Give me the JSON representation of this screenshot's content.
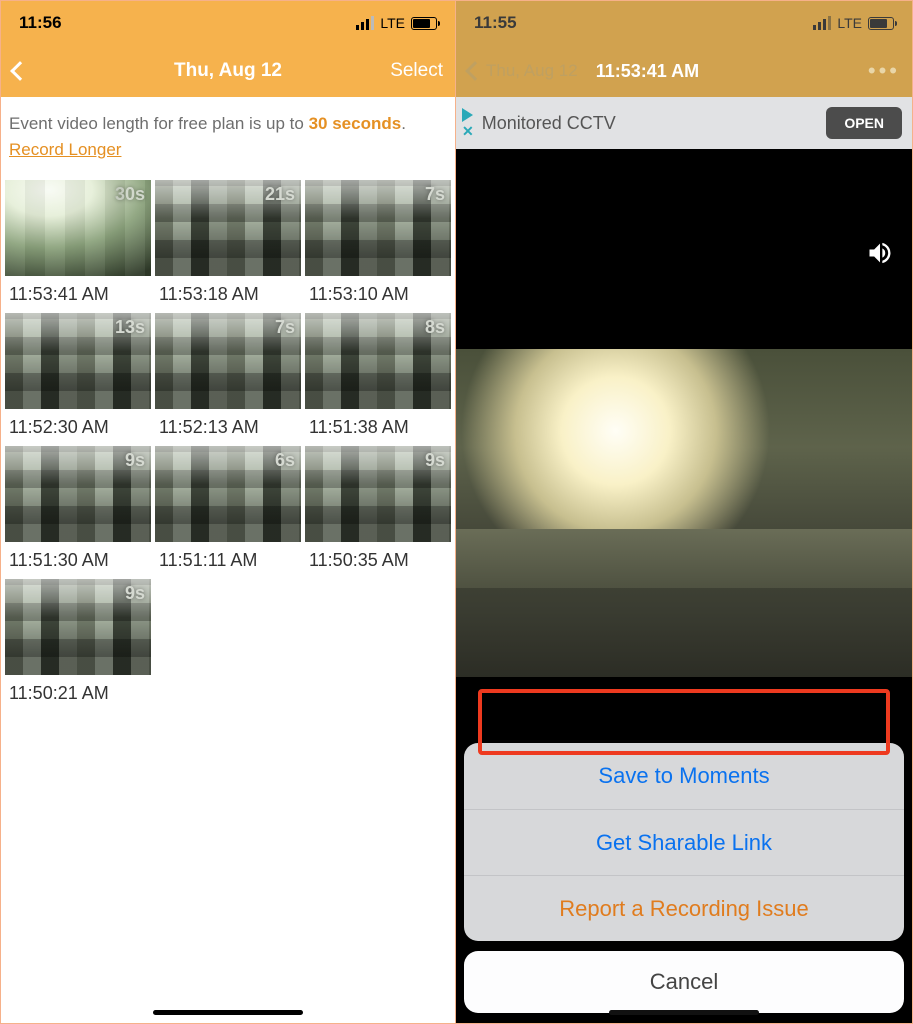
{
  "left": {
    "status_time": "11:56",
    "network_label": "LTE",
    "header_title": "Thu, Aug 12",
    "header_action": "Select",
    "banner_prefix": "Event video length for free plan is up to ",
    "banner_highlight": "30 seconds",
    "banner_suffix": ".",
    "banner_link": "Record Longer",
    "clips": [
      {
        "duration": "30s",
        "time": "11:53:41 AM"
      },
      {
        "duration": "21s",
        "time": "11:53:18 AM"
      },
      {
        "duration": "7s",
        "time": "11:53:10 AM"
      },
      {
        "duration": "13s",
        "time": "11:52:30 AM"
      },
      {
        "duration": "7s",
        "time": "11:52:13 AM"
      },
      {
        "duration": "8s",
        "time": "11:51:38 AM"
      },
      {
        "duration": "9s",
        "time": "11:51:30 AM"
      },
      {
        "duration": "6s",
        "time": "11:51:11 AM"
      },
      {
        "duration": "9s",
        "time": "11:50:35 AM"
      },
      {
        "duration": "9s",
        "time": "11:50:21 AM"
      }
    ]
  },
  "right": {
    "status_time": "11:55",
    "network_label": "LTE",
    "header_date": "Thu, Aug 12",
    "header_timestamp": "11:53:41 AM",
    "ad_label": "Monitored CCTV",
    "ad_button": "OPEN",
    "sheet": {
      "save": "Save to Moments",
      "share": "Get Sharable Link",
      "report": "Report a Recording Issue",
      "cancel": "Cancel"
    }
  }
}
